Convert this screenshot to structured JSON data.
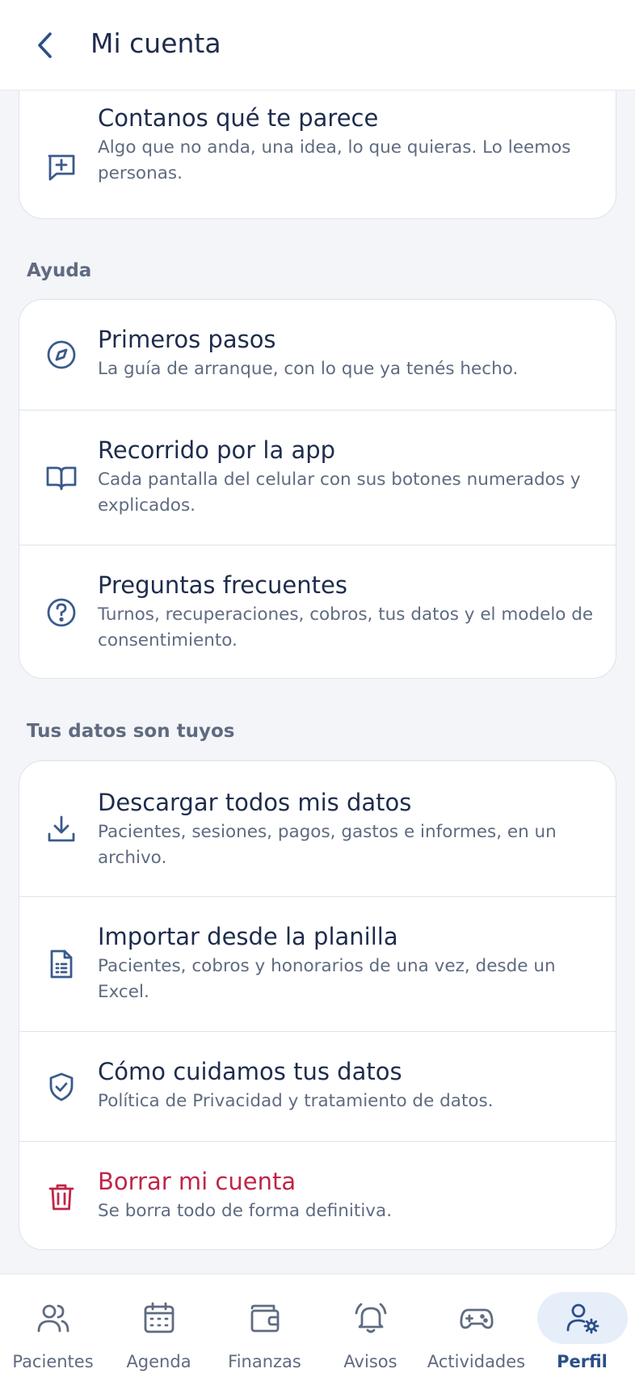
{
  "header": {
    "title": "Mi cuenta"
  },
  "feedback": {
    "title": "Contanos qué te parece",
    "subtitle": "Algo que no anda, una idea, lo que quieras. Lo leemos personas."
  },
  "help_section": {
    "label": "Ayuda",
    "items": [
      {
        "title": "Primeros pasos",
        "subtitle": "La guía de arranque, con lo que ya tenés hecho."
      },
      {
        "title": "Recorrido por la app",
        "subtitle": "Cada pantalla del celular con sus botones numerados y explicados."
      },
      {
        "title": "Preguntas frecuentes",
        "subtitle": "Turnos, recuperaciones, cobros, tus datos y el modelo de consentimiento."
      }
    ]
  },
  "data_section": {
    "label": "Tus datos son tuyos",
    "items": [
      {
        "title": "Descargar todos mis datos",
        "subtitle": "Pacientes, sesiones, pagos, gastos e informes, en un archivo."
      },
      {
        "title": "Importar desde la planilla",
        "subtitle": "Pacientes, cobros y honorarios de una vez, desde un Excel."
      },
      {
        "title": "Cómo cuidamos tus datos",
        "subtitle": "Política de Privacidad y tratamiento de datos."
      },
      {
        "title": "Borrar mi cuenta",
        "subtitle": "Se borra todo de forma definitiva."
      }
    ]
  },
  "tabs": [
    {
      "label": "Pacientes"
    },
    {
      "label": "Agenda"
    },
    {
      "label": "Finanzas"
    },
    {
      "label": "Avisos"
    },
    {
      "label": "Actividades"
    },
    {
      "label": "Perfil"
    }
  ],
  "colors": {
    "accent": "#2b4f88",
    "icon": "#3a5a8c",
    "danger": "#c02547",
    "active_tab_bg": "#e6eef9"
  }
}
